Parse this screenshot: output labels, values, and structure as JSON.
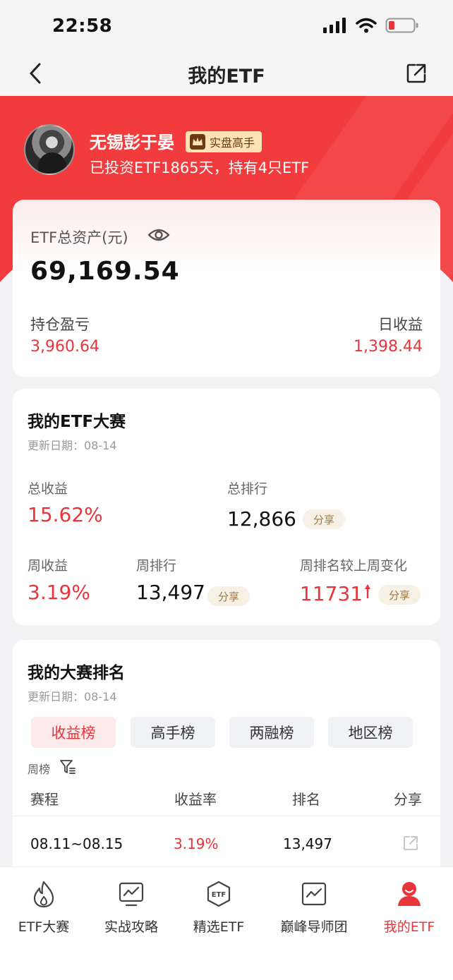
{
  "status_bar": {
    "time": "22:58"
  },
  "navbar": {
    "title": "我的ETF"
  },
  "profile": {
    "name": "无锡彭于晏",
    "badge": "实盘高手",
    "subtitle": "已投资ETF1865天，持有4只ETF"
  },
  "assets": {
    "label": "ETF总资产(元)",
    "total": "69,169.54",
    "holding_label": "持仓盈亏",
    "holding_value": "3,960.64",
    "daily_label": "日收益",
    "daily_value": "1,398.44"
  },
  "contest": {
    "title": "我的ETF大赛",
    "update_date": "更新日期：08-14",
    "total_return_label": "总收益",
    "total_return": "15.62%",
    "total_rank_label": "总排行",
    "total_rank": "12,866",
    "weekly_return_label": "周收益",
    "weekly_return": "3.19%",
    "weekly_rank_label": "周排行",
    "weekly_rank": "13,497",
    "rank_change_label": "周排名较上周变化",
    "rank_change": "11731",
    "share_label": "分享"
  },
  "ranking": {
    "title": "我的大赛排名",
    "update_date": "更新日期：08-14",
    "tabs": [
      "收益榜",
      "高手榜",
      "两融榜",
      "地区榜"
    ],
    "active_tab": "收益榜",
    "filter_label": "周榜",
    "columns": [
      "赛程",
      "收益率",
      "排名",
      "分享"
    ],
    "rows": [
      {
        "period": "08.11~08.15",
        "rate": "3.19%",
        "rank": "13,497"
      }
    ]
  },
  "tabbar": {
    "items": [
      {
        "label": "ETF大赛",
        "icon": "flame-icon"
      },
      {
        "label": "实战攻略",
        "icon": "chart-monitor-icon"
      },
      {
        "label": "精选ETF",
        "icon": "etf-badge-icon"
      },
      {
        "label": "巅峰导师团",
        "icon": "pulse-board-icon"
      },
      {
        "label": "我的ETF",
        "icon": "user-icon"
      }
    ],
    "active": "我的ETF"
  },
  "colors": {
    "accent": "#e7353a",
    "hero": "#f23b3d",
    "share_pill_bg": "#f7f0e5",
    "badge_bg": "#fde2b5"
  }
}
